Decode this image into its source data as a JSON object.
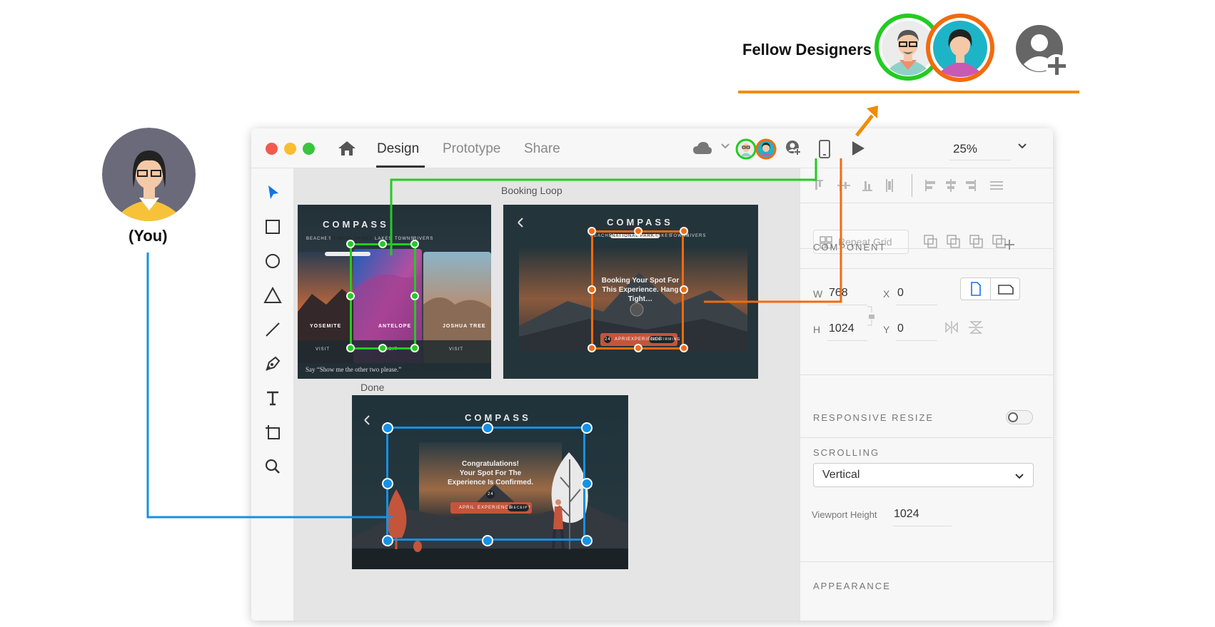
{
  "annotations": {
    "fellow_designers_label": "Fellow Designers",
    "you_label": "(You)"
  },
  "colors": {
    "collaborator_green": "#22cc22",
    "collaborator_orange": "#f26b0f",
    "you_blue": "#1591e5",
    "fellow_line": "#f08c00",
    "accent_blue": "#1473e6"
  },
  "window": {
    "tabs": [
      {
        "label": "Design",
        "active": true
      },
      {
        "label": "Prototype",
        "active": false
      },
      {
        "label": "Share",
        "active": false
      }
    ],
    "zoom": "25%"
  },
  "toolbar": {
    "tools": [
      "select-icon",
      "rectangle-icon",
      "ellipse-icon",
      "polygon-icon",
      "line-icon",
      "pen-icon",
      "text-icon",
      "artboard-icon",
      "zoom-icon"
    ]
  },
  "canvas": {
    "artboard_labels": {
      "booking_loop": "Booking Loop",
      "done": "Done"
    },
    "artboard1": {
      "title": "COMPASS",
      "nav_items": [
        "BEACHES",
        "NATIONAL PARKS",
        "LAKES",
        "TOWNS",
        "RIVERS"
      ],
      "cards": [
        "YOSEMITE",
        "ANTELOPE",
        "JOSHUA TREE"
      ],
      "card_action": "VISIT",
      "caption": "Say “Show me the other two please.”"
    },
    "artboard2": {
      "title": "COMPASS",
      "nav_items": [
        "BEACHES",
        "NATIONAL PARKS",
        "LAKES",
        "TOWNS",
        "RIVERS"
      ],
      "message": "Booking Your Spot For This Experience. Hang Tight…",
      "bar_number": "24",
      "bar_items": [
        "APRIL",
        "EXPERIENCE"
      ],
      "bar_button": "CONFIRMING"
    },
    "artboard3": {
      "title": "COMPASS",
      "message_line1": "Congratulations!",
      "message_line2": "Your Spot For The",
      "message_line3": "Experience Is Confirmed.",
      "bar_number": "24",
      "bar_items": [
        "APRIL",
        "EXPERIENCE"
      ],
      "bar_button": "RECEIPT"
    }
  },
  "panel": {
    "repeat_grid": "Repeat Grid",
    "component": "COMPONENT",
    "w_label": "W",
    "w_value": "768",
    "h_label": "H",
    "h_value": "1024",
    "x_label": "X",
    "x_value": "0",
    "y_label": "Y",
    "y_value": "0",
    "responsive_resize": "RESPONSIVE RESIZE",
    "responsive_enabled": false,
    "scrolling": "SCROLLING",
    "scroll_value": "Vertical",
    "viewport_height_label": "Viewport Height",
    "viewport_height_value": "1024",
    "appearance": "APPEARANCE"
  }
}
